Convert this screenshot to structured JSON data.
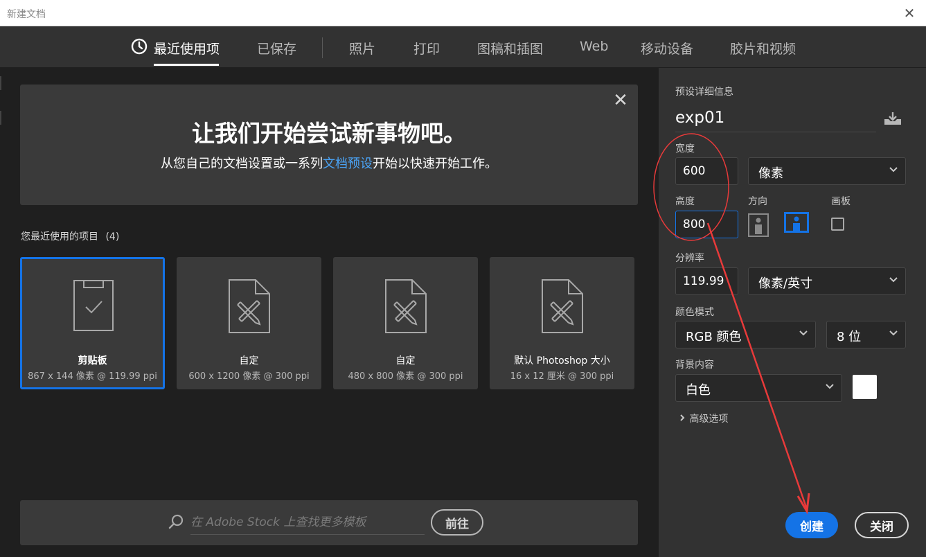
{
  "window": {
    "title": "新建文档",
    "close_glyph": "✕"
  },
  "tabs": [
    {
      "label": "最近使用项",
      "active": true
    },
    {
      "label": "已保存"
    },
    {
      "label": "照片"
    },
    {
      "label": "打印"
    },
    {
      "label": "图稿和插图"
    },
    {
      "label": "Web"
    },
    {
      "label": "移动设备"
    },
    {
      "label": "胶片和视频"
    }
  ],
  "welcome": {
    "heading": "让我们开始尝试新事物吧。",
    "sub_before": "从您自己的文档设置或一系列",
    "sub_link": "文档预设",
    "sub_after": "开始以快速开始工作。",
    "dismiss_glyph": "✕"
  },
  "recent": {
    "label": "您最近使用的项目",
    "count": "(4)",
    "items": [
      {
        "name": "剪贴板",
        "meta": "867 x 144 像素 @ 119.99 ppi",
        "icon": "clipboard-check-icon",
        "selected": true
      },
      {
        "name": "自定",
        "meta": "600 x 1200 像素 @ 300 ppi",
        "icon": "document-ruler-pencil-icon"
      },
      {
        "name": "自定",
        "meta": "480 x 800 像素 @ 300 ppi",
        "icon": "document-ruler-pencil-icon"
      },
      {
        "name": "默认 Photoshop 大小",
        "meta": "16 x 12 厘米 @ 300 ppi",
        "icon": "document-ruler-pencil-icon"
      }
    ]
  },
  "stock": {
    "placeholder": "在 Adobe Stock 上查找更多模板",
    "go_label": "前往"
  },
  "preset": {
    "section_label": "预设详细信息",
    "name": "exp01",
    "width_label": "宽度",
    "width_value": "600",
    "width_unit": "像素",
    "height_label": "高度",
    "height_value": "800",
    "orientation_label": "方向",
    "artboard_label": "画板",
    "resolution_label": "分辨率",
    "resolution_value": "119.99",
    "resolution_unit": "像素/英寸",
    "color_mode_label": "颜色模式",
    "color_mode": "RGB 颜色",
    "bit_depth": "8 位",
    "background_label": "背景内容",
    "background": "白色",
    "advanced_label": "高级选项"
  },
  "actions": {
    "create_label": "创建",
    "close_label": "关闭"
  },
  "colors": {
    "accent": "#1473e6",
    "link": "#4aa3f5",
    "annotation": "#e83a3a",
    "background_swatch": "#ffffff"
  }
}
